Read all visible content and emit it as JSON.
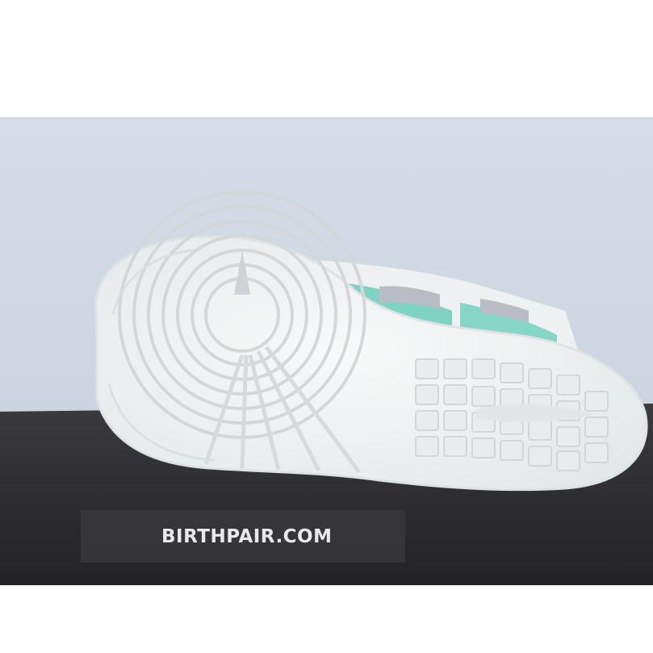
{
  "watermark": {
    "text": "BIRTHPAIR.COM"
  },
  "photo": {
    "subject": "sneaker-outsole",
    "colors": {
      "background_wall": "#ccd5e2",
      "table_surface": "#2c2c30",
      "sole": "#f2f3f3",
      "accent_mint": "#7fd3c2",
      "accent_grey": "#b9bcc2"
    }
  }
}
